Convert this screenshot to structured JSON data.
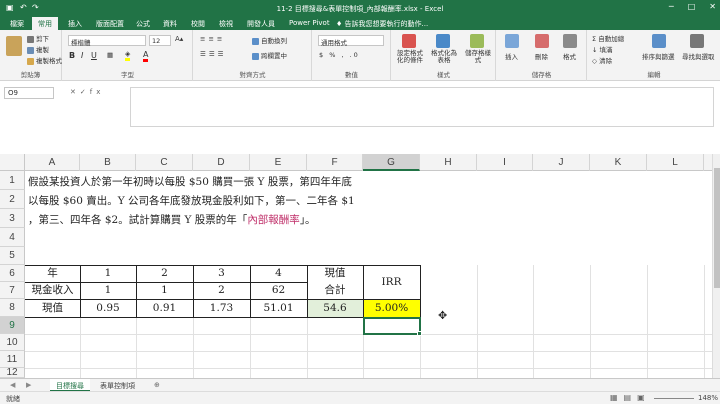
{
  "window": {
    "title": "11-2 目標搜尋&表單控制項_內部報酬率.xlsx - Excel",
    "controls": [
      "─",
      "□",
      "✕"
    ]
  },
  "tabs": [
    "檔案",
    "常用",
    "插入",
    "版面配置",
    "公式",
    "資料",
    "校閱",
    "檢視",
    "開發人員",
    "Power Pivot"
  ],
  "tell_me": "告訴我您想要執行的動作...",
  "ribbon": {
    "clipboard": {
      "label": "剪貼簿",
      "cut": "剪下",
      "copy": "複製",
      "format_painter": "複製格式"
    },
    "font": {
      "label": "字型",
      "name": "標楷體",
      "size": "12"
    },
    "alignment": {
      "label": "對齊方式",
      "wrap": "自動換列",
      "merge": "跨欄置中"
    },
    "number": {
      "label": "數值",
      "format": "通用格式"
    },
    "styles": {
      "label": "樣式",
      "conditional": "設定格式化的條件",
      "table": "格式化為表格",
      "cell": "儲存格樣式"
    },
    "cells": {
      "label": "儲存格",
      "insert": "插入",
      "delete": "刪除",
      "format": "格式"
    },
    "editing": {
      "label": "編輯",
      "autosum": "自動加總",
      "fill": "填滿",
      "clear": "清除",
      "sort": "排序與篩選",
      "find": "尋找與選取"
    }
  },
  "formula_bar": {
    "name_box": "O9",
    "fx": "fx",
    "value": ""
  },
  "columns": [
    "A",
    "B",
    "C",
    "D",
    "E",
    "F",
    "G",
    "H",
    "I",
    "J",
    "K",
    "L"
  ],
  "rows": [
    "1",
    "2",
    "3",
    "4",
    "5",
    "6",
    "7",
    "8",
    "9",
    "10",
    "11",
    "12",
    "13"
  ],
  "problem": {
    "line1": "假設某投資人於第一年初時以每股 $50 購買一張 Y 股票，第四年年底",
    "line2": "以每股 $60 賣出。Y 公司各年底發放現金股利如下，第一、二年各 $1",
    "line3_a": "，第三、四年各 $2。試計算購買 Y 股票的年「",
    "line3_highlight": "內部報酬率",
    "line3_b": "」。"
  },
  "table": {
    "row6": {
      "label": "年",
      "years": [
        "1",
        "2",
        "3",
        "4"
      ],
      "pv_header": "現值"
    },
    "row7": {
      "label": "現金收入",
      "cash": [
        "1",
        "1",
        "2",
        "62"
      ],
      "pv_header2": "合計",
      "irr_header": "IRR"
    },
    "row8": {
      "label": "現值",
      "pv": [
        "0.95",
        "0.91",
        "1.73",
        "51.01"
      ],
      "total": "54.6",
      "irr": "5.00%"
    }
  },
  "sheets": [
    "目標搜尋",
    "表單控制項"
  ],
  "status": {
    "ready": "就緒",
    "zoom": "148%"
  },
  "colors": {
    "excel_green": "#217346",
    "irr_fill": "#ffff00",
    "total_fill": "#e2efda",
    "highlight_text": "#c0306a"
  }
}
